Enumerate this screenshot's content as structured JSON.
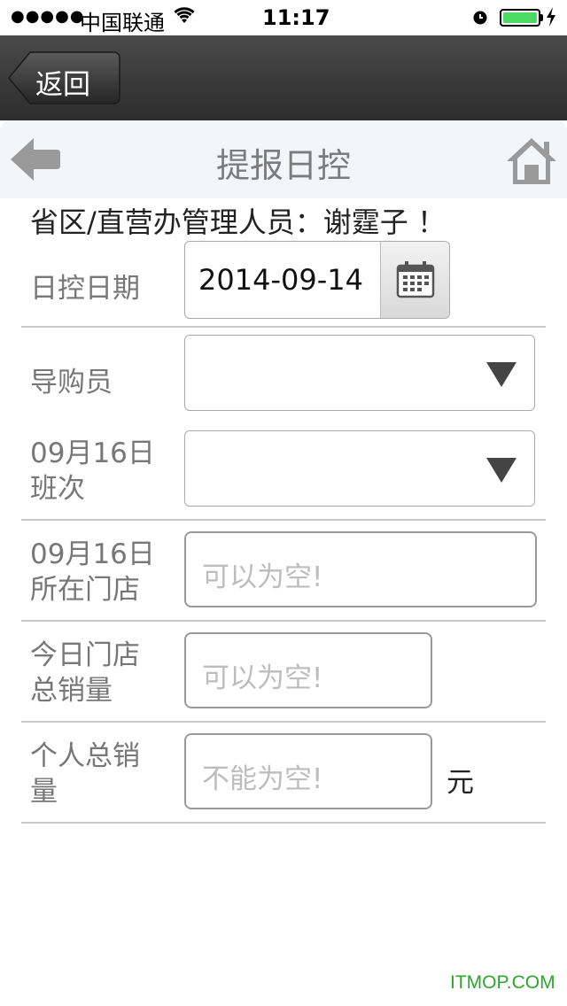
{
  "status_bar": {
    "signal": "●●●●●",
    "carrier": "中国联通",
    "time": "11:17"
  },
  "nav": {
    "back_label": "返回"
  },
  "page": {
    "title": "提报日控",
    "greeting": "省区/直营办管理人员：谢霆子 ！"
  },
  "form": {
    "date_label": "日控日期",
    "date_value": "2014-09-14",
    "guide_label": "导购员",
    "shift_label_line1": "09月16日",
    "shift_label_line2": "班次",
    "store_label_line1": "09月16日",
    "store_label_line2": "所在门店",
    "store_placeholder": "可以为空!",
    "store_total_label_line1": "今日门店",
    "store_total_label_line2": "总销量",
    "store_total_placeholder": "可以为空!",
    "personal_total_label_line1": "个人总销",
    "personal_total_label_line2": "量",
    "personal_total_placeholder": "不能为空!",
    "unit": "元"
  },
  "watermark": "ITMOP.COM",
  "colors": {
    "navbar": "#3a3a3a",
    "battery": "#4cd964",
    "watermark": "#2ea52e"
  }
}
